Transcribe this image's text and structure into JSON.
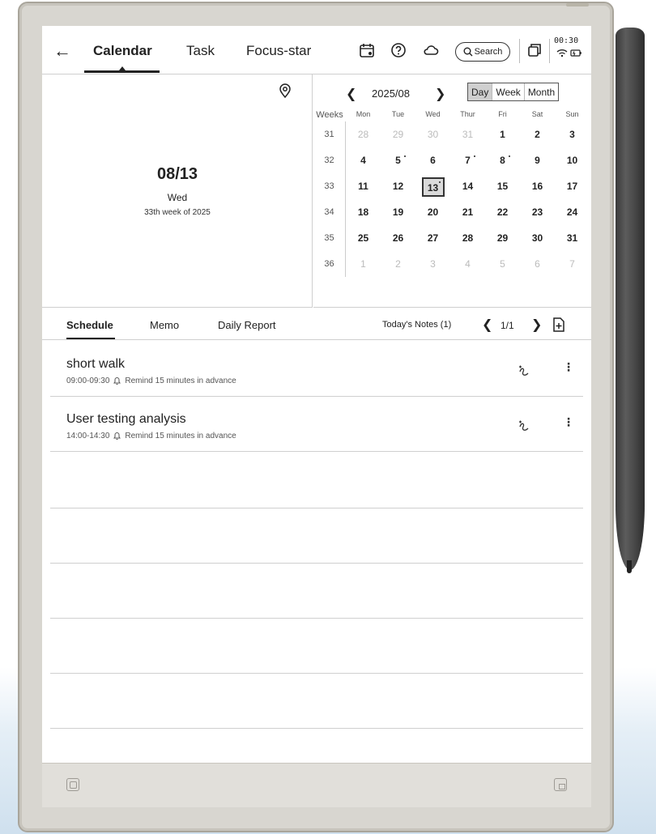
{
  "top_bar": {
    "tabs": [
      {
        "label": "Calendar"
      },
      {
        "label": "Task"
      },
      {
        "label": "Focus-star"
      }
    ],
    "search_label": "Search",
    "time": "00:30"
  },
  "date_panel": {
    "date": "08/13",
    "weekday": "Wed",
    "week_of": "33th week of 2025"
  },
  "calendar": {
    "month_label": "2025/08",
    "views": [
      "Day",
      "Week",
      "Month"
    ],
    "active_view": "Day",
    "weeks_label": "Weeks",
    "day_headers": [
      "Mon",
      "Tue",
      "Wed",
      "Thur",
      "Fri",
      "Sat",
      "Sun"
    ],
    "rows": [
      {
        "week": "31",
        "days": [
          "28",
          "29",
          "30",
          "31",
          "1",
          "2",
          "3"
        ]
      },
      {
        "week": "32",
        "days": [
          "4",
          "5",
          "6",
          "7",
          "8",
          "9",
          "10"
        ]
      },
      {
        "week": "33",
        "days": [
          "11",
          "12",
          "13",
          "14",
          "15",
          "16",
          "17"
        ]
      },
      {
        "week": "34",
        "days": [
          "18",
          "19",
          "20",
          "21",
          "22",
          "23",
          "24"
        ]
      },
      {
        "week": "35",
        "days": [
          "25",
          "26",
          "27",
          "28",
          "29",
          "30",
          "31"
        ]
      },
      {
        "week": "36",
        "days": [
          "1",
          "2",
          "3",
          "4",
          "5",
          "6",
          "7"
        ]
      }
    ],
    "selected_day": "13"
  },
  "schedule_tabs": {
    "tabs": [
      "Schedule",
      "Memo",
      "Daily Report"
    ],
    "active": "Schedule",
    "notes_link": "Today's Notes (1)",
    "page_count": "1/1"
  },
  "events": [
    {
      "title": "short walk",
      "time": "09:00-09:30",
      "reminder": "Remind 15 minutes in advance"
    },
    {
      "title": "User testing analysis",
      "time": "14:00-14:30",
      "reminder": "Remind 15 minutes in advance"
    }
  ],
  "icons": {
    "back": "back-arrow-icon",
    "calendar": "calendar-icon",
    "help": "help-icon",
    "sync": "cloud-sync-icon",
    "search": "search-icon",
    "pages": "pages-icon",
    "wifi": "wifi-icon",
    "battery": "battery-icon",
    "location": "location-icon",
    "add_page": "add-page-icon",
    "bell": "bell-icon",
    "handwriting": "handwriting-icon",
    "more": "more-icon"
  }
}
